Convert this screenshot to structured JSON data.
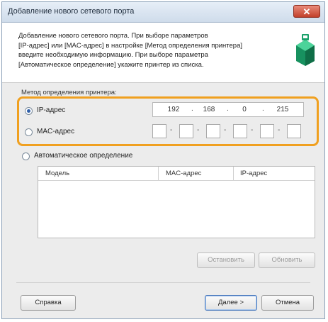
{
  "window": {
    "title": "Добавление нового сетевого порта",
    "close_glyph": "✕"
  },
  "description": {
    "lines": [
      "Добавление нового сетевого порта. При выборе параметров",
      "[IP-адрес] или [MAC-адрес] в настройке [Метод определения принтера]",
      "введите необходимую информацию. При выборе параметра",
      "[Автоматическое определение] укажите принтер из списка."
    ]
  },
  "detection": {
    "group_label": "Метод определения принтера:",
    "ip_option": {
      "label": "IP-адрес",
      "selected": true
    },
    "ip_value": [
      "192",
      "168",
      "0",
      "215"
    ],
    "mac_option": {
      "label": "MAC-адрес",
      "selected": false
    },
    "mac_separator": "-",
    "auto_option": {
      "label": "Автоматическое определение",
      "selected": false
    }
  },
  "printer_table": {
    "columns": [
      "Модель",
      "MAC-адрес",
      "IP-адрес"
    ],
    "rows": []
  },
  "buttons": {
    "stop": "Остановить",
    "refresh": "Обновить",
    "help": "Справка",
    "next": "Далее >",
    "cancel": "Отмена"
  },
  "colors": {
    "highlight": "#f0a020",
    "accent": "#2f5fa8",
    "icon_primary": "#1aa06a"
  },
  "icons": {
    "network_port": "network-port-icon",
    "close": "close-icon"
  }
}
